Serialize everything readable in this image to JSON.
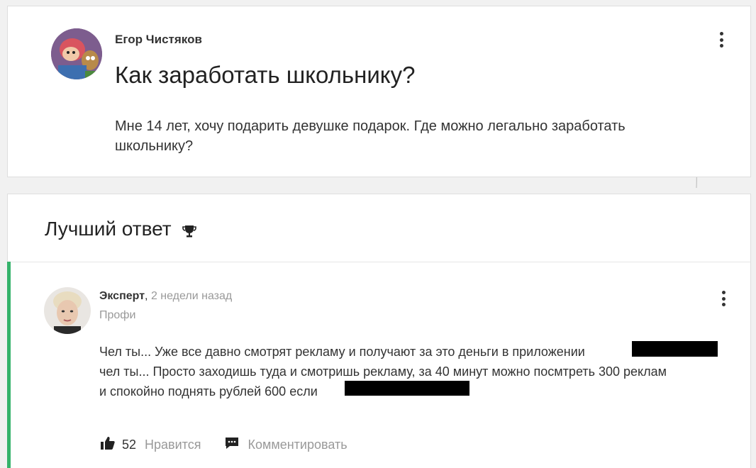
{
  "question": {
    "author": "Егор Чистяков",
    "title": "Как заработать школьнику?",
    "body": "Мне 14 лет, хочу подарить девушке подарок. Где можно легально заработать школьнику?"
  },
  "best_answer": {
    "header": "Лучший ответ",
    "author": "Эксперт",
    "separator": ",",
    "time": "2 недели назад",
    "rank": "Профи",
    "body_lines": [
      "Чел ты... Уже все давно смотрят рекламу и получают за это деньги в приложении",
      "чел ты... Просто заходишь туда и смотришь рекламу, за 40 минут можно посмтреть 300 реклам",
      "и спокойно поднять рублей 600 если"
    ],
    "likes": "52",
    "like_label": "Нравится",
    "comment_label": "Комментировать"
  },
  "colors": {
    "accent_green": "#35b36b",
    "muted_text": "#999999",
    "card_bg": "#ffffff",
    "page_bg": "#f1f1f1"
  },
  "icons": [
    "avatar-question",
    "avatar-expert",
    "kebab-menu-icon",
    "trophy-icon",
    "thumbs-up-icon",
    "comment-icon"
  ]
}
